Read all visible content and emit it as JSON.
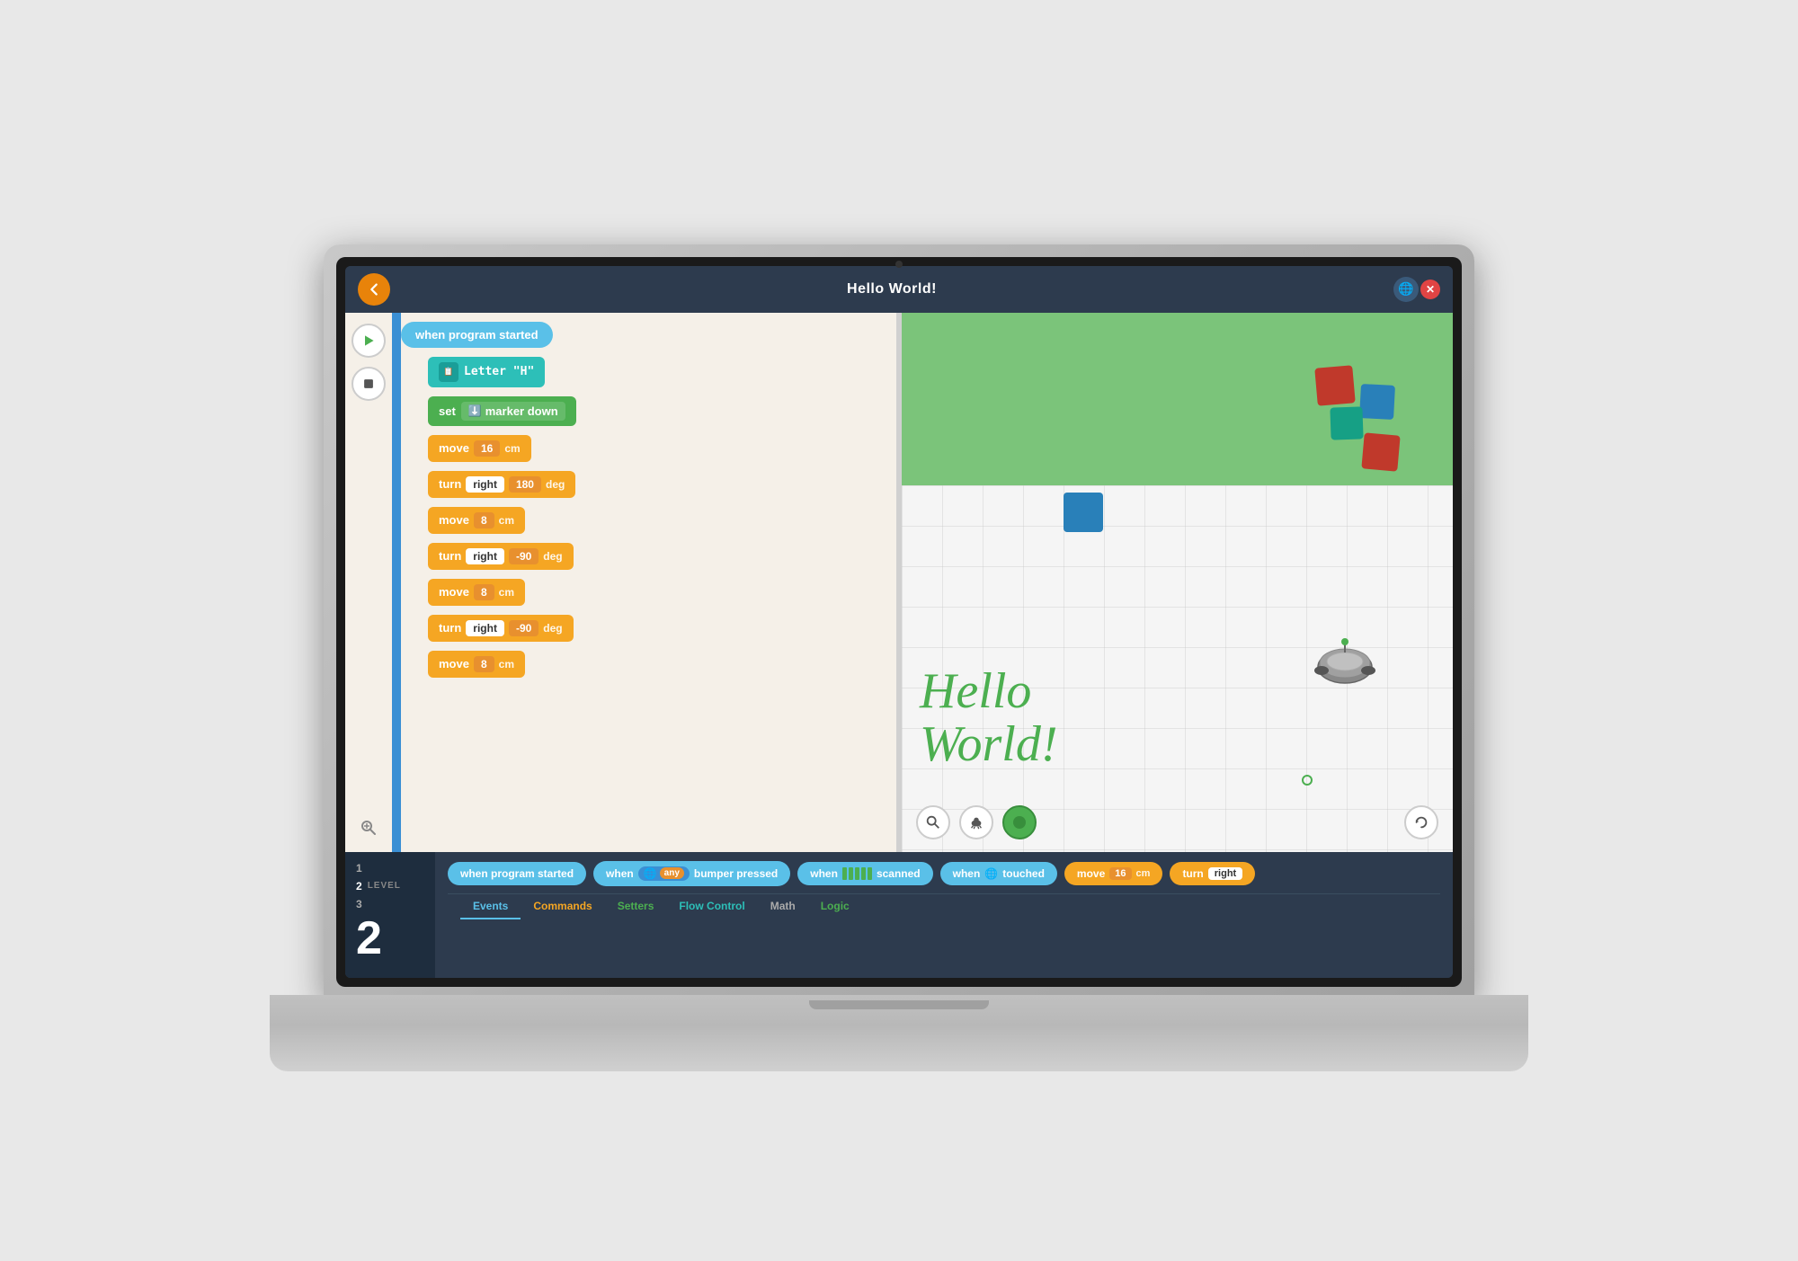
{
  "app": {
    "title": "Hello World!",
    "back_label": "←",
    "close_label": "✕"
  },
  "toolbar": {
    "play_label": "▶",
    "stop_label": "■",
    "zoom_label": "+"
  },
  "code_blocks": [
    {
      "type": "event",
      "text": "when program started"
    },
    {
      "type": "letter",
      "icon": "📄",
      "text": "Letter \"H\""
    },
    {
      "type": "set",
      "text": "set",
      "inner": "marker down"
    },
    {
      "type": "move",
      "text": "move",
      "num": "16",
      "unit": "cm"
    },
    {
      "type": "turn",
      "text": "turn",
      "dir": "right",
      "num": "180",
      "unit": "deg"
    },
    {
      "type": "move",
      "text": "move",
      "num": "8",
      "unit": "cm"
    },
    {
      "type": "turn",
      "text": "turn",
      "dir": "right",
      "num": "-90",
      "unit": "deg"
    },
    {
      "type": "move",
      "text": "move",
      "num": "8",
      "unit": "cm"
    },
    {
      "type": "turn",
      "text": "turn",
      "dir": "right",
      "num": "-90",
      "unit": "deg"
    },
    {
      "type": "move",
      "text": "move",
      "num": "8",
      "unit": "cm"
    }
  ],
  "simulation": {
    "text_line1": "Hello",
    "text_line2": "World!",
    "text_color": "#4caf50"
  },
  "sim_controls": {
    "zoom_icon": "🔍",
    "turtle_icon": "🐢",
    "play_icon": "●",
    "reload_icon": "↻"
  },
  "level": {
    "label": "LEVEL",
    "number": "2",
    "items": [
      "1",
      "2",
      "3"
    ]
  },
  "palette": {
    "blocks": [
      {
        "type": "blue",
        "text": "when program started"
      },
      {
        "type": "blue_any",
        "text": "bumper pressed",
        "prefix": "when",
        "badge": "any"
      },
      {
        "type": "blue_scan",
        "text": "scanned",
        "prefix": "when"
      },
      {
        "type": "blue_globe",
        "text": "touched",
        "prefix": "when"
      },
      {
        "type": "yellow_move",
        "text": "move",
        "num": "16",
        "unit": "cm"
      },
      {
        "type": "yellow_turn",
        "text": "turn",
        "dir": "right"
      }
    ]
  },
  "categories": [
    {
      "label": "Events",
      "style": "active-blue"
    },
    {
      "label": "Commands",
      "style": "active-yellow"
    },
    {
      "label": "Setters",
      "style": "active-green"
    },
    {
      "label": "Flow Control",
      "style": "active-teal"
    },
    {
      "label": "Math",
      "style": "active-gray"
    },
    {
      "label": "Logic",
      "style": "active-green"
    }
  ]
}
